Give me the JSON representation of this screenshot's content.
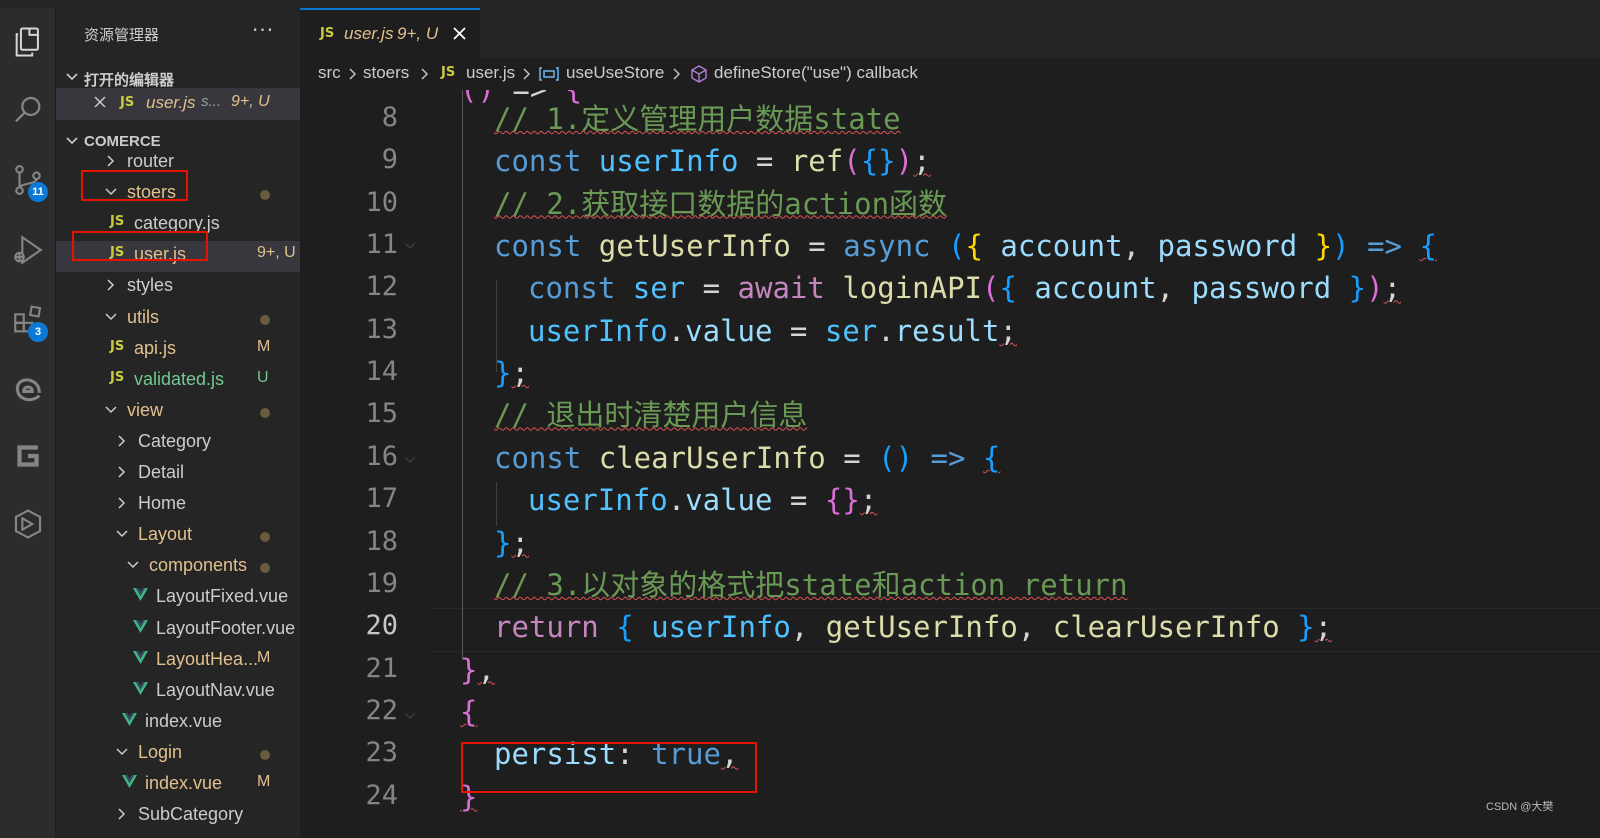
{
  "sidebar": {
    "title": "资源管理器",
    "more": "···",
    "open_editors_header": "打开的编辑器",
    "open_editor": {
      "icon": "JS",
      "name": "user.js",
      "folder": "s...",
      "status": "9+, U"
    },
    "project_header": "COMERCE",
    "tree": [
      {
        "label": "router",
        "kind": "folder",
        "expanded": false,
        "color": "#cccccc"
      },
      {
        "label": "stoers",
        "kind": "folder",
        "expanded": true,
        "color": "#e2c08d",
        "dot": true
      },
      {
        "label": "category.js",
        "kind": "js",
        "icon": "JS",
        "color": "#cccccc"
      },
      {
        "label": "user.js",
        "kind": "js",
        "icon": "JS",
        "color": "#e2c08d",
        "git": "9+, U",
        "selected": true
      },
      {
        "label": "styles",
        "kind": "folder",
        "expanded": false,
        "color": "#cccccc"
      },
      {
        "label": "utils",
        "kind": "folder",
        "expanded": true,
        "color": "#e2c08d",
        "dot": true
      },
      {
        "label": "api.js",
        "kind": "js",
        "icon": "JS",
        "color": "#e2c08d",
        "git": "M"
      },
      {
        "label": "validated.js",
        "kind": "js",
        "icon": "JS",
        "color": "#73c991",
        "git": "U"
      },
      {
        "label": "view",
        "kind": "folder",
        "expanded": true,
        "color": "#e2c08d",
        "dot": true
      },
      {
        "label": "Category",
        "kind": "folder",
        "expanded": false,
        "color": "#cccccc"
      },
      {
        "label": "Detail",
        "kind": "folder",
        "expanded": false,
        "color": "#cccccc"
      },
      {
        "label": "Home",
        "kind": "folder",
        "expanded": false,
        "color": "#cccccc"
      },
      {
        "label": "Layout",
        "kind": "folder",
        "expanded": true,
        "color": "#e2c08d",
        "dot": true
      },
      {
        "label": "components",
        "kind": "folder",
        "expanded": true,
        "color": "#e2c08d",
        "dot": true
      },
      {
        "label": "LayoutFixed.vue",
        "kind": "vue",
        "color": "#cccccc"
      },
      {
        "label": "LayoutFooter.vue",
        "kind": "vue",
        "color": "#cccccc"
      },
      {
        "label": "LayoutHea...",
        "kind": "vue",
        "color": "#e2c08d",
        "git": "M"
      },
      {
        "label": "LayoutNav.vue",
        "kind": "vue",
        "color": "#cccccc"
      },
      {
        "label": "index.vue",
        "kind": "vue",
        "color": "#cccccc"
      },
      {
        "label": "Login",
        "kind": "folder",
        "expanded": true,
        "color": "#e2c08d",
        "dot": true
      },
      {
        "label": "index.vue",
        "kind": "vue",
        "color": "#e2c08d",
        "git": "M"
      },
      {
        "label": "SubCategory",
        "kind": "folder",
        "expanded": false,
        "color": "#cccccc"
      }
    ]
  },
  "activity": {
    "icons": [
      "explorer-icon",
      "search-icon",
      "source-control-icon",
      "run-debug-icon",
      "extensions-icon",
      "edge-icon",
      "gitlens-icon",
      "remote-explorer-icon"
    ],
    "source_control_badge": "11",
    "extensions_badge": "3"
  },
  "tab": {
    "icon": "JS",
    "name": "user.js",
    "status": "9+, U",
    "close": "×"
  },
  "breadcrumb": {
    "src": "src",
    "folder": "stoers",
    "file_icon": "JS",
    "file": "user.js",
    "symbol1": "useUseStore",
    "symbol2": "defineStore(\"use\") callback"
  },
  "editor": {
    "line_numbers": [
      "8",
      "9",
      "10",
      "11",
      "12",
      "13",
      "14",
      "15",
      "16",
      "17",
      "18",
      "19",
      "20",
      "21",
      "22",
      "23",
      "24"
    ],
    "active_line": "20",
    "code": [
      [
        [
          "c-com",
          "// 1.定义管理用户数据state"
        ]
      ],
      [
        [
          "c-kw",
          "const "
        ],
        [
          "c-var",
          "userInfo"
        ],
        [
          "c-op",
          " = "
        ],
        [
          "c-fn",
          "ref"
        ],
        [
          "c-b2",
          "("
        ],
        [
          "c-b3",
          "{}"
        ],
        [
          "c-b2",
          ")"
        ],
        [
          "c-pl",
          ";"
        ]
      ],
      [
        [
          "c-com",
          "// 2.获取接口数据的action函数"
        ]
      ],
      [
        [
          "c-kw",
          "const "
        ],
        [
          "c-fn",
          "getUserInfo"
        ],
        [
          "c-op",
          " = "
        ],
        [
          "c-kw",
          "async "
        ],
        [
          "c-b3",
          "("
        ],
        [
          "c-b1",
          "{ "
        ],
        [
          "c-prop",
          "account"
        ],
        [
          "c-pl",
          ", "
        ],
        [
          "c-prop",
          "password"
        ],
        [
          "c-b1",
          " }"
        ],
        [
          "c-b3",
          ")"
        ],
        [
          "c-op",
          " "
        ],
        [
          "c-kw",
          "=>"
        ],
        [
          "c-op",
          " "
        ],
        [
          "c-b3",
          "{"
        ]
      ],
      [
        [
          "c-kw",
          "const "
        ],
        [
          "c-var",
          "ser"
        ],
        [
          "c-op",
          " = "
        ],
        [
          "c-ctl",
          "await "
        ],
        [
          "c-fn",
          "loginAPI"
        ],
        [
          "c-b2",
          "("
        ],
        [
          "c-b3",
          "{ "
        ],
        [
          "c-prop",
          "account"
        ],
        [
          "c-pl",
          ", "
        ],
        [
          "c-prop",
          "password"
        ],
        [
          "c-b3",
          " }"
        ],
        [
          "c-b2",
          ")"
        ],
        [
          "c-pl",
          ";"
        ]
      ],
      [
        [
          "c-var",
          "userInfo"
        ],
        [
          "c-pl",
          "."
        ],
        [
          "c-prop",
          "value"
        ],
        [
          "c-op",
          " = "
        ],
        [
          "c-var",
          "ser"
        ],
        [
          "c-pl",
          "."
        ],
        [
          "c-prop",
          "result"
        ],
        [
          "c-pl",
          ";"
        ]
      ],
      [
        [
          "c-b3",
          "}"
        ],
        [
          "c-pl",
          ";"
        ]
      ],
      [
        [
          "c-com",
          "// 退出时清楚用户信息"
        ]
      ],
      [
        [
          "c-kw",
          "const "
        ],
        [
          "c-fn",
          "clearUserInfo"
        ],
        [
          "c-op",
          " = "
        ],
        [
          "c-b3",
          "()"
        ],
        [
          "c-op",
          " "
        ],
        [
          "c-kw",
          "=>"
        ],
        [
          "c-op",
          " "
        ],
        [
          "c-b3",
          "{"
        ]
      ],
      [
        [
          "c-var",
          "userInfo"
        ],
        [
          "c-pl",
          "."
        ],
        [
          "c-prop",
          "value"
        ],
        [
          "c-op",
          " = "
        ],
        [
          "c-b2",
          "{}"
        ],
        [
          "c-pl",
          ";"
        ]
      ],
      [
        [
          "c-b3",
          "}"
        ],
        [
          "c-pl",
          ";"
        ]
      ],
      [
        [
          "c-com",
          "// 3.以对象的格式把state和action return"
        ]
      ],
      [
        [
          "c-ctl",
          "return "
        ],
        [
          "c-b3",
          "{ "
        ],
        [
          "c-var",
          "userInfo"
        ],
        [
          "c-pl",
          ", "
        ],
        [
          "c-fn",
          "getUserInfo"
        ],
        [
          "c-pl",
          ", "
        ],
        [
          "c-fn",
          "clearUserInfo"
        ],
        [
          "c-b3",
          " }"
        ],
        [
          "c-pl",
          ";"
        ]
      ],
      [
        [
          "c-b2",
          "}"
        ],
        [
          "c-pl",
          ","
        ]
      ],
      [
        [
          "c-b2",
          "{"
        ]
      ],
      [
        [
          "c-prop",
          "persist"
        ],
        [
          "c-pl",
          ": "
        ],
        [
          "c-kw",
          "true"
        ],
        [
          "c-pl",
          ","
        ]
      ],
      [
        [
          "c-b2",
          "}"
        ]
      ]
    ]
  },
  "watermark": "CSDN @大樊"
}
